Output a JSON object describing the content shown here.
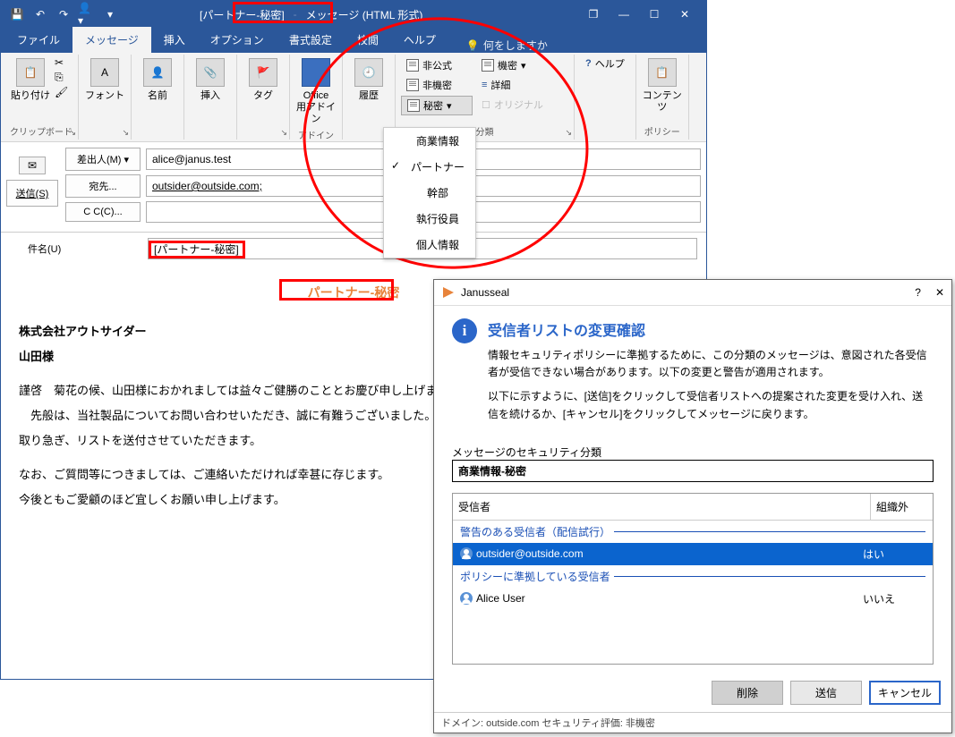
{
  "titlebar": {
    "classification_tag": "[パートナー-秘密]",
    "title_suffix": "メッセージ (HTML 形式)"
  },
  "tabs": {
    "file": "ファイル",
    "message": "メッセージ",
    "insert": "挿入",
    "options": "オプション",
    "format": "書式設定",
    "review": "校閲",
    "help": "ヘルプ",
    "tell_me": "何をしますか"
  },
  "ribbon": {
    "clipboard": {
      "paste": "貼り付け",
      "group": "クリップボード"
    },
    "font": {
      "label": "フォント",
      "group": ""
    },
    "names": {
      "label": "名前"
    },
    "insert": {
      "label": "挿入"
    },
    "tags": {
      "label": "タグ"
    },
    "office": {
      "label": "Office\n用アドイン",
      "group": "アドイン"
    },
    "history": {
      "label": "履歴"
    },
    "classify": {
      "unofficial": "非公式",
      "unclassified": "非機密",
      "secret": "秘密",
      "classified": "機密",
      "details": "詳細",
      "original": "オリジナル",
      "group": "分類"
    },
    "help": {
      "label": "ヘルプ"
    },
    "contents": {
      "label": "コンテンツ",
      "group": "ポリシー"
    }
  },
  "dropdown": {
    "items": [
      "商業情報",
      "パートナー",
      "幹部",
      "執行役員",
      "個人情報"
    ],
    "checked_index": 1
  },
  "compose": {
    "send": "送信(S)",
    "from_label": "差出人(M)",
    "from_value": "alice@janus.test",
    "to_label": "宛先...",
    "to_value": "outsider@outside.com;",
    "cc_label": "C C(C)...",
    "cc_value": "",
    "subject_label": "件名(U)",
    "subject_value": "[パートナー-秘密]"
  },
  "body": {
    "classification": "パートナー-秘密",
    "company": "株式会社アウトサイダー",
    "name": "山田様",
    "p1": "謹啓　菊花の候、山田様におかれましては益々ご健勝のこととお慶び申し上げます。",
    "p2": "　先般は、当社製品についてお問い合わせいただき、誠に有難うございました。",
    "p3": "取り急ぎ、リストを送付させていただきます。",
    "p4": "なお、ご質問等につきましては、ご連絡いただければ幸甚に存じます。",
    "p5": "今後ともご愛顧のほど宜しくお願い申し上げます。"
  },
  "dialog": {
    "title": "Janusseal",
    "heading": "受信者リストの変更確認",
    "desc1": "情報セキュリティポリシーに準拠するために、この分類のメッセージは、意図された各受信者が受信できない場合があります。以下の変更と警告が適用されます。",
    "desc2": "以下に示すように、[送信]をクリックして受信者リストへの提案された変更を受け入れ、送信を続けるか、[キャンセル]をクリックしてメッセージに戻ります。",
    "sec_label": "メッセージのセキュリティ分類",
    "sec_value": "商業情報-秘密",
    "col_recipient": "受信者",
    "col_external": "組織外",
    "group1": "警告のある受信者（配信試行）",
    "group2": "ポリシーに準拠している受信者",
    "recips": [
      {
        "name": "outsider@outside.com",
        "ext": "はい",
        "selected": true,
        "group": 1
      },
      {
        "name": "Alice User",
        "ext": "いいえ",
        "selected": false,
        "group": 2
      }
    ],
    "btn_delete": "削除",
    "btn_send": "送信",
    "btn_cancel": "キャンセル",
    "status": "ドメイン: outside.com セキュリティ評価: 非機密"
  }
}
